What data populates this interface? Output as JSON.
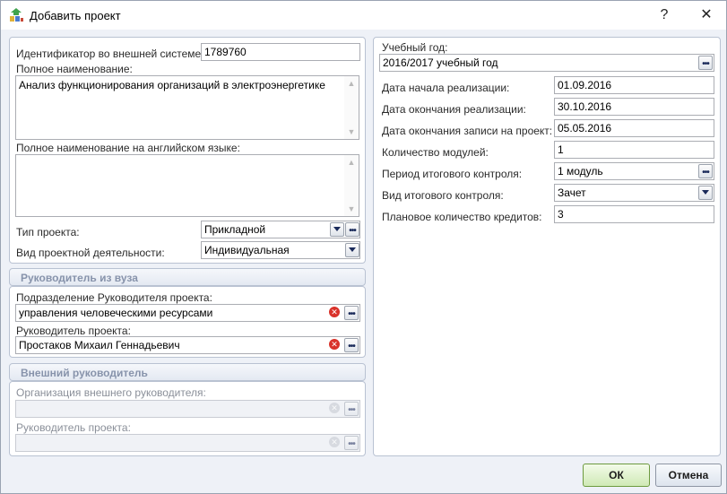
{
  "window": {
    "title": "Добавить проект",
    "help": "?",
    "close": "✕"
  },
  "left": {
    "external_id_label": "Идентификатор во внешней системе:",
    "external_id_value": "1789760",
    "full_name_label": "Полное наименование:",
    "full_name_value": "Анализ функционирования организаций в электроэнергетике",
    "full_name_en_label": "Полное наименование на английском языке:",
    "full_name_en_value": "",
    "project_type_label": "Тип проекта:",
    "project_type_value": "Прикладной",
    "activity_type_label": "Вид проектной деятельности:",
    "activity_type_value": "Индивидуальная"
  },
  "supervisor": {
    "header": "Руководитель из вуза",
    "department_label": "Подразделение Руководителя проекта:",
    "department_value": "управления человеческими ресурсами",
    "head_label": "Руководитель проекта:",
    "head_value": "Простаков Михаил Геннадьевич"
  },
  "external": {
    "header": "Внешний руководитель",
    "org_label": "Организация внешнего руководителя:",
    "org_value": "",
    "head_label": "Руководитель проекта:",
    "head_value": ""
  },
  "right": {
    "year_label": "Учебный год:",
    "year_value": "2016/2017 учебный год",
    "start_label": "Дата начала реализации:",
    "start_value": "01.09.2016",
    "end_label": "Дата окончания реализации:",
    "end_value": "30.10.2016",
    "enroll_end_label": "Дата окончания записи на проект:",
    "enroll_end_value": "05.05.2016",
    "modules_label": "Количество модулей:",
    "modules_value": "1",
    "control_period_label": "Период итогового контроля:",
    "control_period_value": "1 модуль",
    "control_type_label": "Вид итогового контроля:",
    "control_type_value": "Зачет",
    "credits_label": "Плановое количество кредитов:",
    "credits_value": "3"
  },
  "footer": {
    "ok": "ОК",
    "cancel": "Отмена"
  }
}
